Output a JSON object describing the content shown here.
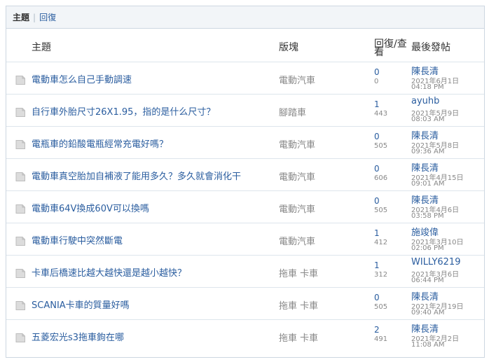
{
  "tabs": {
    "active": "主題",
    "separator": "|",
    "link": "回復"
  },
  "header": {
    "title": "主題",
    "forum": "版塊",
    "replies_views": "回復/查看",
    "last_post": "最後發帖"
  },
  "threads": [
    {
      "title": "電動車怎么自己手動調速",
      "forum": "電動汽車",
      "replies": "0",
      "views": "0",
      "last_user": "陳長清",
      "last_date": "2021年6月1日",
      "last_time": "04:18 PM"
    },
    {
      "title": "自行車外胎尺寸26X1.95，指的是什么尺寸？",
      "forum": "腳踏車",
      "replies": "1",
      "views": "443",
      "last_user": "ayuhb",
      "last_date": "2021年5月9日",
      "last_time": "08:03 AM"
    },
    {
      "title": "電瓶車的鉛酸電瓶經常充電好嗎？",
      "forum": "電動汽車",
      "replies": "0",
      "views": "505",
      "last_user": "陳長清",
      "last_date": "2021年5月8日",
      "last_time": "09:36 AM"
    },
    {
      "title": "電動車真空胎加自補液了能用多久？多久就會消化干",
      "forum": "電動汽車",
      "replies": "0",
      "views": "606",
      "last_user": "陳長清",
      "last_date": "2021年4月15日",
      "last_time": "09:01 AM"
    },
    {
      "title": "電動車64V換成60V可以換嗎",
      "forum": "電動汽車",
      "replies": "0",
      "views": "505",
      "last_user": "陳長清",
      "last_date": "2021年4月6日",
      "last_time": "03:58 PM"
    },
    {
      "title": "電動車行駛中突然斷電",
      "forum": "電動汽車",
      "replies": "1",
      "views": "412",
      "last_user": "施竣偉",
      "last_date": "2021年3月10日",
      "last_time": "02:06 PM"
    },
    {
      "title": "卡車后橋速比越大越快還是越小越快？",
      "forum": "拖車 卡車",
      "replies": "1",
      "views": "312",
      "last_user": "WILLY6219",
      "last_date": "2021年3月6日",
      "last_time": "06:44 PM"
    },
    {
      "title": "SCANIA卡車的質量好嗎",
      "forum": "拖車 卡車",
      "replies": "0",
      "views": "505",
      "last_user": "陳長清",
      "last_date": "2021年2月19日",
      "last_time": "09:40 AM"
    },
    {
      "title": "五菱宏光s3拖車鉤在哪",
      "forum": "拖車 卡車",
      "replies": "2",
      "views": "491",
      "last_user": "陳長清",
      "last_date": "2021年2月2日",
      "last_time": "11:08 AM"
    }
  ]
}
